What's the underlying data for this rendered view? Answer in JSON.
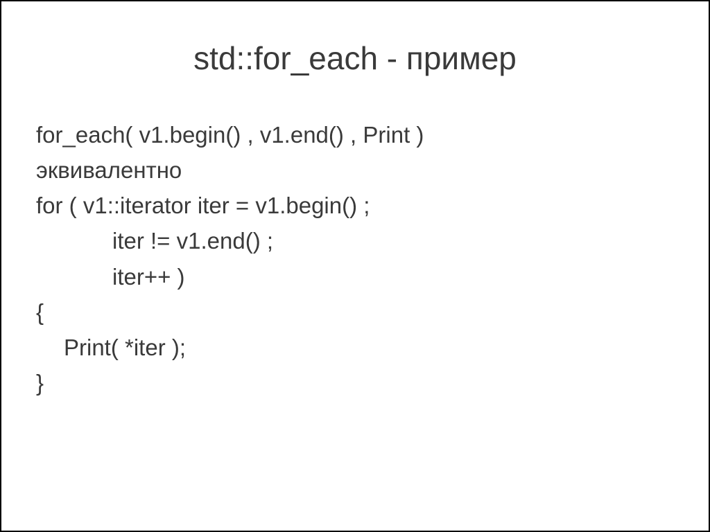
{
  "title": "std::for_each - пример",
  "lines": {
    "l1": "for_each( v1.begin() , v1.end() , Print )",
    "l2": "эквивалентно",
    "l3": "for ( v1::iterator iter = v1.begin() ;",
    "l4": "iter != v1.end() ;",
    "l5": "iter++ )",
    "l6": "{",
    "l7": "Print( *iter );",
    "l8": "}"
  }
}
